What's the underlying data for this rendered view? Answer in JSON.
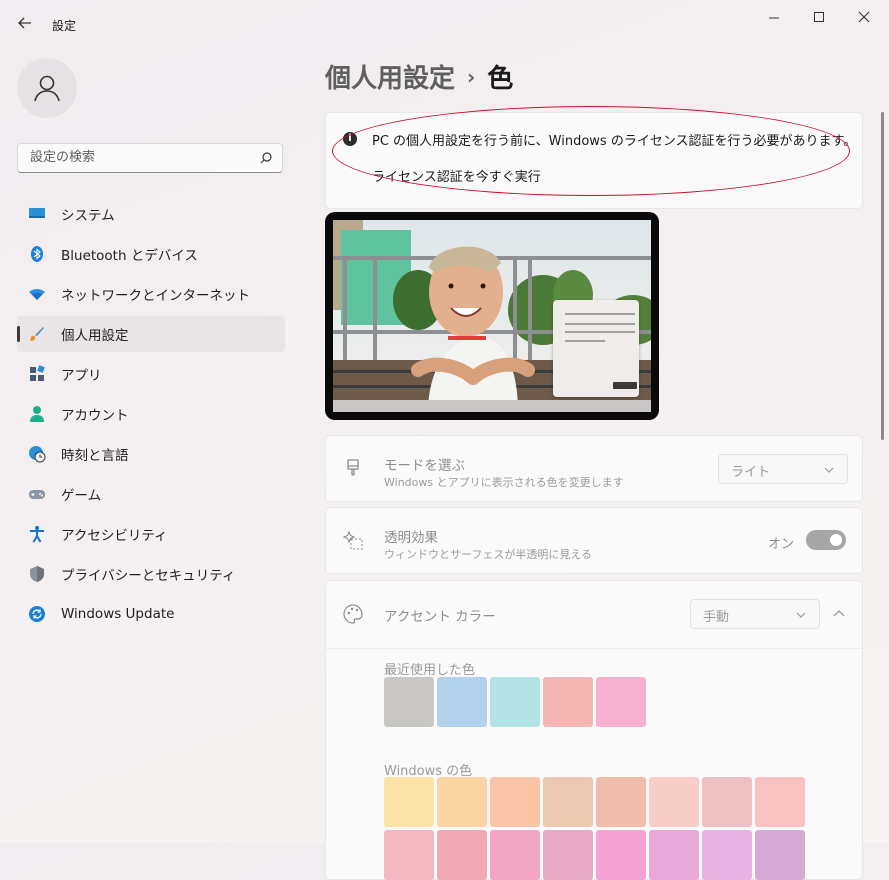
{
  "window": {
    "title": "設定"
  },
  "sidebar": {
    "search_placeholder": "設定の検索",
    "items": [
      {
        "label": "システム",
        "icon": "monitor-icon",
        "selected": false
      },
      {
        "label": "Bluetooth とデバイス",
        "icon": "bluetooth-icon",
        "selected": false
      },
      {
        "label": "ネットワークとインターネット",
        "icon": "wifi-icon",
        "selected": false
      },
      {
        "label": "個人用設定",
        "icon": "brush-icon",
        "selected": true
      },
      {
        "label": "アプリ",
        "icon": "apps-icon",
        "selected": false
      },
      {
        "label": "アカウント",
        "icon": "person-icon",
        "selected": false
      },
      {
        "label": "時刻と言語",
        "icon": "globe-clock-icon",
        "selected": false
      },
      {
        "label": "ゲーム",
        "icon": "gamepad-icon",
        "selected": false
      },
      {
        "label": "アクセシビリティ",
        "icon": "accessibility-icon",
        "selected": false
      },
      {
        "label": "プライバシーとセキュリティ",
        "icon": "shield-icon",
        "selected": false
      },
      {
        "label": "Windows Update",
        "icon": "update-icon",
        "selected": false
      }
    ]
  },
  "main": {
    "breadcrumb_parent": "個人用設定",
    "breadcrumb_separator": "›",
    "breadcrumb_current": "色",
    "banner": {
      "message": "PC の個人用設定を行う前に、Windows のライセンス認証を行う必要があります。",
      "link": "ライセンス認証を今すぐ実行"
    },
    "mode": {
      "title": "モードを選ぶ",
      "subtitle": "Windows とアプリに表示される色を変更します",
      "value": "ライト"
    },
    "transparency": {
      "title": "透明効果",
      "subtitle": "ウィンドウとサーフェスが半透明に見える",
      "state_label": "オン"
    },
    "accent": {
      "title": "アクセント カラー",
      "value": "手動",
      "recent_label": "最近使用した色",
      "recent_colors": [
        "#c8c7c3",
        "#b2d1ec",
        "#b3e3e5",
        "#f5b5b5",
        "#f5b1cf"
      ],
      "windows_label": "Windows の色",
      "windows_colors_row1": [
        "#fde2a8",
        "#fcd3a3",
        "#f9c5a6",
        "#ecc8b3",
        "#f2bcab",
        "#f8cdc7",
        "#eec0c2",
        "#f9c1c1"
      ],
      "windows_colors_row2": [
        "#f5b8c2",
        "#f3a9b5",
        "#f2a6c4",
        "#e8a9c4",
        "#f4a2d2",
        "#e8a8d8",
        "#e9b2e2",
        "#d9a9d6"
      ]
    }
  },
  "colors": {
    "selection_bg": "#e9e4e6",
    "annotation_ellipse": "#c8102e",
    "toggle_off_gray": "#a6a6a6"
  }
}
